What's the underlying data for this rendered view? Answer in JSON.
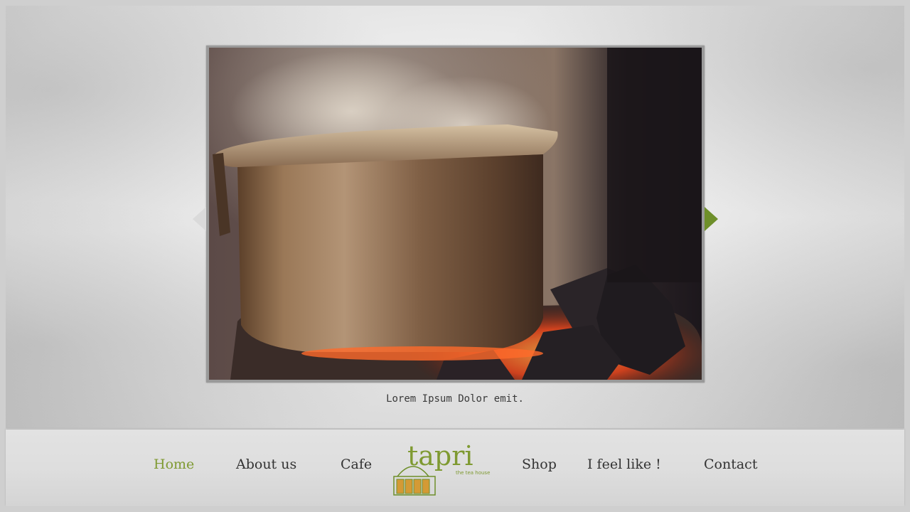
{
  "slider": {
    "caption": "Lorem Ipsum Dolor emit."
  },
  "nav": {
    "home": "Home",
    "about": "About us",
    "cafe": "Cafe",
    "shop": "Shop",
    "feel": "I feel like !",
    "contact": "Contact"
  },
  "logo": {
    "name": "tapri",
    "tagline": "the tea house"
  },
  "colors": {
    "accent": "#7f9a32",
    "text": "#333333"
  },
  "icons": {
    "prev": "arrow-left-icon",
    "next": "arrow-right-icon"
  }
}
